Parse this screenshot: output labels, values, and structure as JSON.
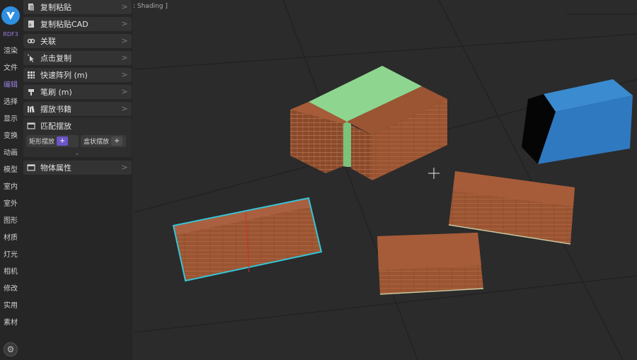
{
  "viewport": {
    "shading_label": ": Shading ]"
  },
  "rail": {
    "version": "RDF3",
    "items": [
      "渲染",
      "文件",
      "编辑",
      "选择",
      "显示",
      "变换",
      "动画",
      "模型",
      "室内",
      "室外",
      "图形",
      "材质",
      "灯光",
      "相机",
      "修改",
      "实用",
      "素材"
    ],
    "active_index": 2
  },
  "panel": {
    "items": [
      {
        "label": "复制粘贴",
        "icon": "clipboard-icon"
      },
      {
        "label": "复制粘贴CAD",
        "icon": "cad-file-icon"
      },
      {
        "label": "关联",
        "icon": "link-icon"
      },
      {
        "label": "点击复制",
        "icon": "click-icon"
      },
      {
        "label": "快速阵列 (m)",
        "icon": "grid-icon"
      },
      {
        "label": "笔刷 (m)",
        "icon": "brush-icon"
      },
      {
        "label": "摆放书籍",
        "icon": "books-icon"
      },
      {
        "label": "匹配摆放",
        "icon": "window-icon"
      },
      {
        "label": "物体属性",
        "icon": "window-icon"
      }
    ],
    "sub_buttons": [
      {
        "label": "矩形摆放",
        "action": "+"
      },
      {
        "label": "盒状摆放",
        "action": "+"
      }
    ],
    "accent_color": "#6b55c8"
  }
}
